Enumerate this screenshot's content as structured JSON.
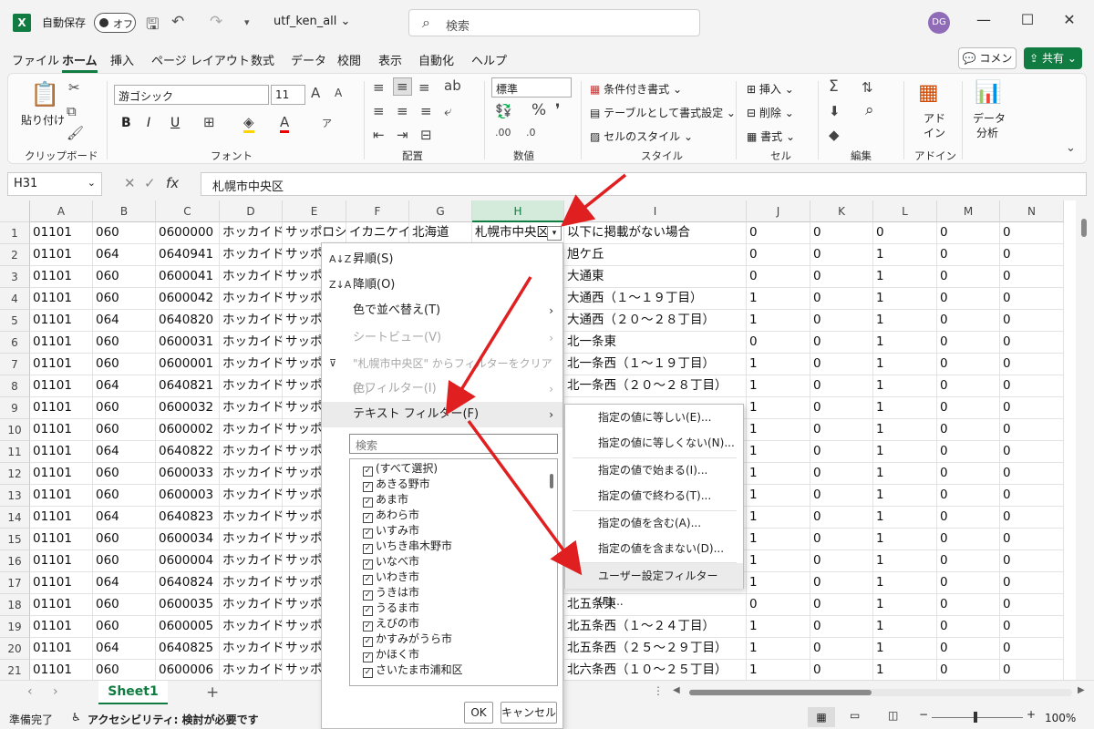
{
  "titlebar": {
    "app_icon": "X",
    "autosave_label": "自動保存",
    "autosave_state": "オフ",
    "filename": "utf_ken_all",
    "search_placeholder": "検索",
    "user_initials": "DG"
  },
  "menu_tabs": [
    "ファイル",
    "ホーム",
    "挿入",
    "ページ レイアウト",
    "数式",
    "データ",
    "校閲",
    "表示",
    "自動化",
    "ヘルプ"
  ],
  "active_tab": "ホーム",
  "comment_label": "コメント",
  "share_label": "共有",
  "ribbon": {
    "clipboard": {
      "paste": "貼り付け",
      "label": "クリップボード"
    },
    "font": {
      "name": "游ゴシック",
      "size": "11",
      "label": "フォント",
      "bold": "B",
      "italic": "I",
      "underline": "U"
    },
    "alignment": {
      "label": "配置"
    },
    "number": {
      "format": "標準",
      "label": "数値"
    },
    "styles": {
      "conditional": "条件付き書式",
      "table": "テーブルとして書式設定",
      "cell": "セルのスタイル",
      "label": "スタイル"
    },
    "cells": {
      "insert": "挿入",
      "delete": "削除",
      "format": "書式",
      "label": "セル"
    },
    "editing": {
      "label": "編集"
    },
    "addins": {
      "btn_line1": "アド",
      "btn_line2": "イン",
      "label": "アドイン"
    },
    "analysis": {
      "btn_line1": "データ",
      "btn_line2": "分析"
    }
  },
  "formula_bar": {
    "cell_ref": "H31",
    "fx": "fx",
    "value": "札幌市中央区"
  },
  "columns": [
    "A",
    "B",
    "C",
    "D",
    "E",
    "F",
    "G",
    "H",
    "I",
    "J",
    "K",
    "L",
    "M",
    "N"
  ],
  "selected_column": "H",
  "row_numbers": [
    "1",
    "2",
    "3",
    "4",
    "5",
    "6",
    "7",
    "8",
    "9",
    "10",
    "11",
    "12",
    "13",
    "14",
    "15",
    "16",
    "17",
    "18",
    "19",
    "20",
    "21"
  ],
  "rows": [
    [
      "01101",
      "060",
      "0600000",
      "ホッカイドウ",
      "サッポロシ",
      "イカニケイ",
      "北海道",
      "札幌市中央区",
      "以下に掲載がない場合",
      "0",
      "0",
      "0",
      "0",
      "0"
    ],
    [
      "01101",
      "064",
      "0640941",
      "ホッカイドウ",
      "サッポロシ",
      "",
      "",
      "",
      "旭ケ丘",
      "0",
      "0",
      "1",
      "0",
      "0"
    ],
    [
      "01101",
      "060",
      "0600041",
      "ホッカイドウ",
      "サッポロシ",
      "",
      "",
      "",
      "大通東",
      "0",
      "0",
      "1",
      "0",
      "0"
    ],
    [
      "01101",
      "060",
      "0600042",
      "ホッカイドウ",
      "サッポロシ",
      "",
      "",
      "",
      "大通西（１～１９丁目）",
      "1",
      "0",
      "1",
      "0",
      "0"
    ],
    [
      "01101",
      "064",
      "0640820",
      "ホッカイドウ",
      "サッポロシ",
      "",
      "",
      "",
      "大通西（２０～２８丁目）",
      "1",
      "0",
      "1",
      "0",
      "0"
    ],
    [
      "01101",
      "060",
      "0600031",
      "ホッカイドウ",
      "サッポロシ",
      "",
      "",
      "",
      "北一条東",
      "0",
      "0",
      "1",
      "0",
      "0"
    ],
    [
      "01101",
      "060",
      "0600001",
      "ホッカイドウ",
      "サッポロシ",
      "",
      "",
      "",
      "北一条西（１～１９丁目）",
      "1",
      "0",
      "1",
      "0",
      "0"
    ],
    [
      "01101",
      "064",
      "0640821",
      "ホッカイドウ",
      "サッポロシ",
      "",
      "",
      "",
      "北一条西（２０～２８丁目）",
      "1",
      "0",
      "1",
      "0",
      "0"
    ],
    [
      "01101",
      "060",
      "0600032",
      "ホッカイドウ",
      "サッポロシ",
      "",
      "",
      "",
      "",
      "1",
      "0",
      "1",
      "0",
      "0"
    ],
    [
      "01101",
      "060",
      "0600002",
      "ホッカイドウ",
      "サッポロシ",
      "",
      "",
      "",
      "",
      "1",
      "0",
      "1",
      "0",
      "0"
    ],
    [
      "01101",
      "064",
      "0640822",
      "ホッカイドウ",
      "サッポロシ",
      "",
      "",
      "",
      "",
      "1",
      "0",
      "1",
      "0",
      "0"
    ],
    [
      "01101",
      "060",
      "0600033",
      "ホッカイドウ",
      "サッポロシ",
      "",
      "",
      "",
      "",
      "1",
      "0",
      "1",
      "0",
      "0"
    ],
    [
      "01101",
      "060",
      "0600003",
      "ホッカイドウ",
      "サッポロシ",
      "",
      "",
      "",
      "",
      "1",
      "0",
      "1",
      "0",
      "0"
    ],
    [
      "01101",
      "064",
      "0640823",
      "ホッカイドウ",
      "サッポロシ",
      "",
      "",
      "",
      "",
      "1",
      "0",
      "1",
      "0",
      "0"
    ],
    [
      "01101",
      "060",
      "0600034",
      "ホッカイドウ",
      "サッポロシ",
      "",
      "",
      "",
      "",
      "1",
      "0",
      "1",
      "0",
      "0"
    ],
    [
      "01101",
      "060",
      "0600004",
      "ホッカイドウ",
      "サッポロシ",
      "",
      "",
      "",
      "",
      "1",
      "0",
      "1",
      "0",
      "0"
    ],
    [
      "01101",
      "064",
      "0640824",
      "ホッカイドウ",
      "サッポロシ",
      "",
      "",
      "",
      "",
      "1",
      "0",
      "1",
      "0",
      "0"
    ],
    [
      "01101",
      "060",
      "0600035",
      "ホッカイドウ",
      "サッポロシ",
      "",
      "",
      "",
      "北五条東",
      "0",
      "0",
      "1",
      "0",
      "0"
    ],
    [
      "01101",
      "060",
      "0600005",
      "ホッカイドウ",
      "サッポロシ",
      "",
      "",
      "",
      "北五条西（１～２４丁目）",
      "1",
      "0",
      "1",
      "0",
      "0"
    ],
    [
      "01101",
      "064",
      "0640825",
      "ホッカイドウ",
      "サッポロシ",
      "",
      "",
      "",
      "北五条西（２５～２９丁目）",
      "1",
      "0",
      "1",
      "0",
      "0"
    ],
    [
      "01101",
      "060",
      "0600006",
      "ホッカイドウ",
      "サッポロシ",
      "",
      "",
      "",
      "北六条西（１０～２５丁目）",
      "1",
      "0",
      "1",
      "0",
      "0"
    ]
  ],
  "filter_menu": {
    "sort_asc": "昇順(S)",
    "sort_desc": "降順(O)",
    "sort_color": "色で並べ替え(T)",
    "sheet_view": "シートビュー(V)",
    "clear_filter": "\"札幌市中央区\" からフィルターをクリア(C)",
    "color_filter": "色フィルター(I)",
    "text_filter": "テキスト フィルター(F)",
    "search_placeholder": "検索",
    "list_items": [
      "(すべて選択)",
      "あきる野市",
      "あま市",
      "あわら市",
      "いすみ市",
      "いちき串木野市",
      "いなべ市",
      "いわき市",
      "うきは市",
      "うるま市",
      "えびの市",
      "かすみがうら市",
      "かほく市",
      "さいたま市浦和区"
    ],
    "ok": "OK",
    "cancel": "キャンセル"
  },
  "submenu": [
    "指定の値に等しい(E)...",
    "指定の値に等しくない(N)...",
    "指定の値で始まる(I)...",
    "指定の値で終わる(T)...",
    "指定の値を含む(A)...",
    "指定の値を含まない(D)...",
    "ユーザー設定フィルター(F)..."
  ],
  "sheet_tab": "Sheet1",
  "statusbar": {
    "ready": "準備完了",
    "accessibility": "アクセシビリティ: 検討が必要です",
    "zoom": "100%"
  },
  "colors": {
    "excel_green": "#107c41",
    "arrow_red": "#e02020"
  }
}
